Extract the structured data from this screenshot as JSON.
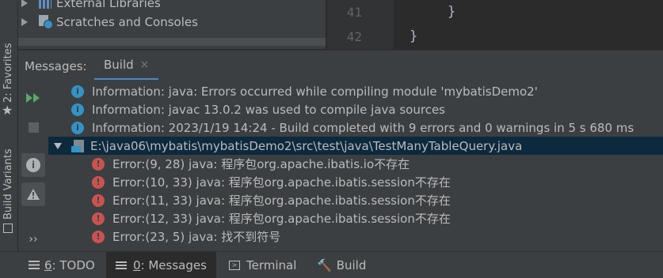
{
  "left_strip": {
    "favorites_label": "2: Favorites",
    "build_variants_label": "Build Variants"
  },
  "project_tree": {
    "items": [
      {
        "label": "External Libraries"
      },
      {
        "label": "Scratches and Consoles"
      }
    ]
  },
  "editor": {
    "lines": [
      {
        "number": "41",
        "code": "}"
      },
      {
        "number": "42",
        "code": "}"
      }
    ]
  },
  "tool_window": {
    "title": "Messages:",
    "tab_label": "Build",
    "tab_close": "×"
  },
  "messages": [
    {
      "type": "info",
      "text": "Information: java: Errors occurred while compiling module 'mybatisDemo2'"
    },
    {
      "type": "info",
      "text": "Information: javac 13.0.2 was used to compile java sources"
    },
    {
      "type": "info",
      "text": "Information: 2023/1/19 14:24 - Build completed with 9 errors and 0 warnings in 5 s 680 ms"
    },
    {
      "type": "file",
      "text": "E:\\java06\\mybatis\\mybatisDemo2\\src\\test\\java\\TestManyTableQuery.java"
    },
    {
      "type": "error",
      "text": "Error:(9, 28)  java: 程序包org.apache.ibatis.io不存在"
    },
    {
      "type": "error",
      "text": "Error:(10, 33)  java: 程序包org.apache.ibatis.session不存在"
    },
    {
      "type": "error",
      "text": "Error:(11, 33)  java: 程序包org.apache.ibatis.session不存在"
    },
    {
      "type": "error",
      "text": "Error:(12, 33)  java: 程序包org.apache.ibatis.session不存在"
    },
    {
      "type": "error",
      "text": "Error:(23, 5)  java: 找不到符号"
    }
  ],
  "bottom_bar": {
    "todo": {
      "mnemonic": "6",
      "label": ": TODO"
    },
    "messages": {
      "mnemonic": "0",
      "label": ": Messages"
    },
    "terminal": "Terminal",
    "build": "Build"
  },
  "colors": {
    "info_icon": "#3592c4",
    "error_icon": "#c75450",
    "run_green": "#59a869",
    "selection": "#0d293e",
    "tab_underline": "#4a88c7"
  }
}
